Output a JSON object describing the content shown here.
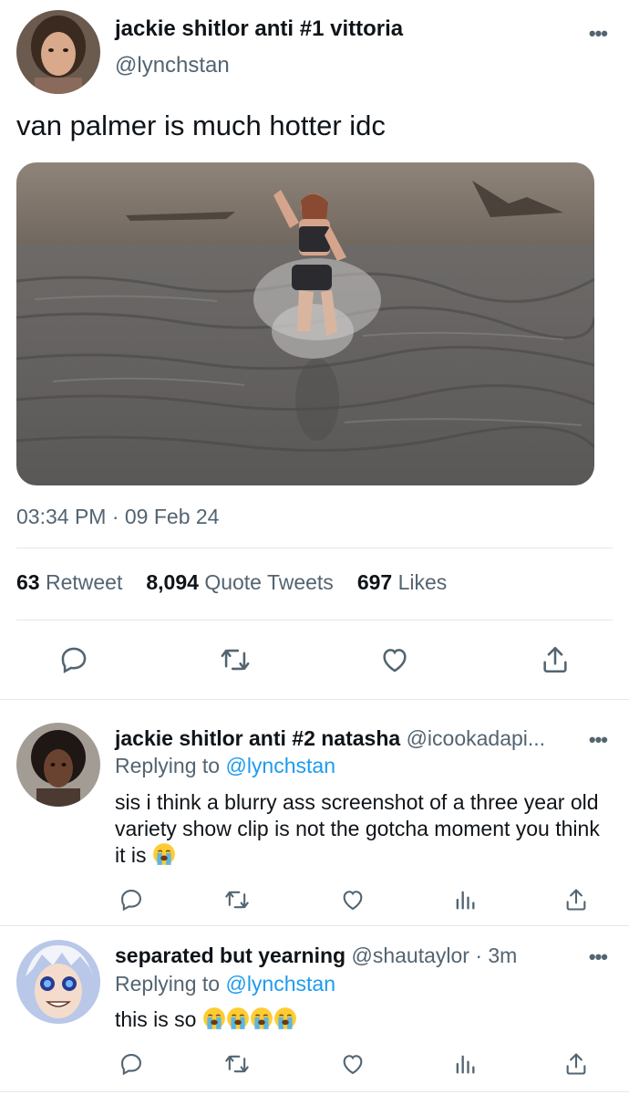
{
  "main_tweet": {
    "name": "jackie shitlor anti #1 vittoria",
    "handle": "@lynchstan",
    "text": "van palmer is much hotter idc",
    "timestamp": "03:34 PM · 09 Feb 24",
    "stats": {
      "retweets_count": "63",
      "retweets_label": "Retweet",
      "quotes_count": "8,094",
      "quotes_label": "Quote Tweets",
      "likes_count": "697",
      "likes_label": "Likes"
    }
  },
  "replies": [
    {
      "name": "jackie shitlor anti #2 natasha",
      "handle": "@icookadapi...",
      "replying_prefix": "Replying to",
      "replying_to": "@lynchstan",
      "text": "sis i think a blurry ass screenshot of a three year old variety show clip is not the gotcha moment you think it is",
      "emoji": [
        "loudly-crying-face"
      ]
    },
    {
      "name": "separated but yearning",
      "handle": "@shautaylor · 3m",
      "replying_prefix": "Replying to",
      "replying_to": "@lynchstan",
      "text": "this is so",
      "emoji": [
        "loudly-crying-face",
        "loudly-crying-face",
        "loudly-crying-face",
        "loudly-crying-face"
      ]
    }
  ],
  "icons": {
    "more": "more-icon",
    "reply": "reply-icon",
    "retweet": "retweet-icon",
    "like": "heart-icon",
    "share": "share-icon",
    "analytics": "analytics-icon"
  },
  "colors": {
    "link": "#1d9bf0",
    "secondary_text": "#536471",
    "divider": "#e1e8ed"
  }
}
